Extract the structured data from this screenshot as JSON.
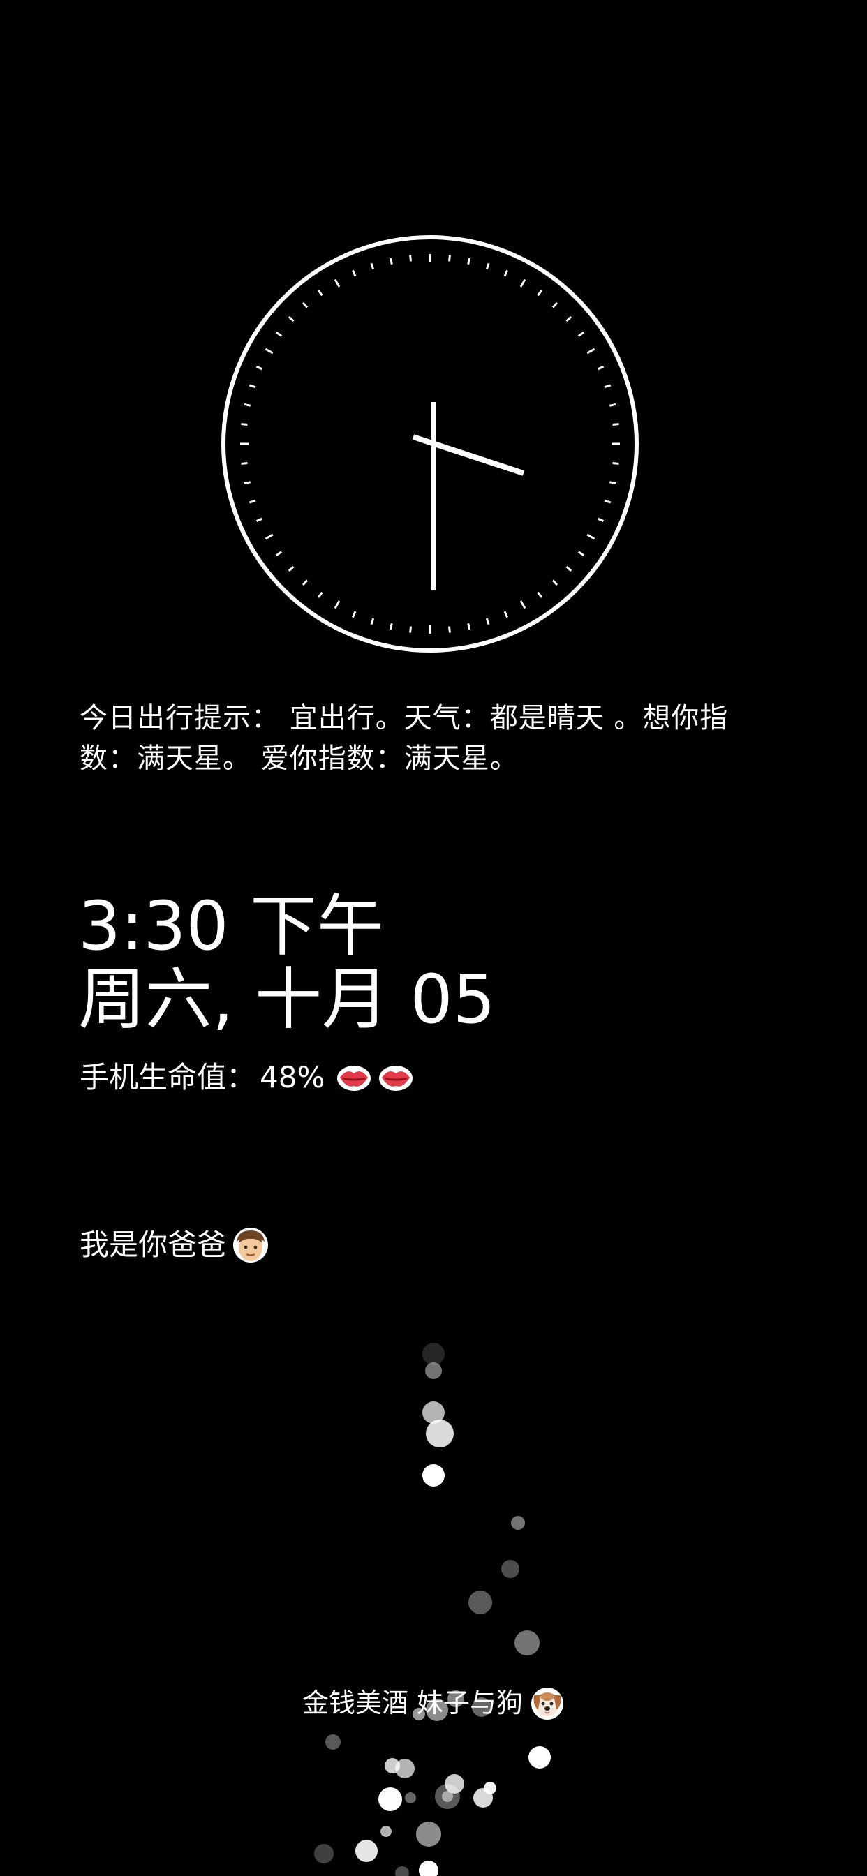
{
  "tip": {
    "label": "今日出行提示：",
    "advice": "宜出行。",
    "weather_label": "天气：",
    "weather_value": "都是晴天 。",
    "miss_label": "想你指数：",
    "miss_value": "满天星。",
    "love_label": "爱你指数：",
    "love_value": "满天星。"
  },
  "time": {
    "clock_text": "3:30 下午",
    "date_text": "周六, 十月 05"
  },
  "battery": {
    "label": "手机生命值：",
    "value": "48%",
    "icons": [
      "kiss-mark-icon",
      "kiss-mark-icon"
    ]
  },
  "identity": {
    "text": "我是你爸爸",
    "icon": "man-face-icon"
  },
  "motto": {
    "text": "金钱美酒 妹子与狗",
    "icon": "dog-face-icon"
  },
  "colors": {
    "background": "#000000",
    "foreground": "#ffffff",
    "kiss": "#e23b4a"
  }
}
